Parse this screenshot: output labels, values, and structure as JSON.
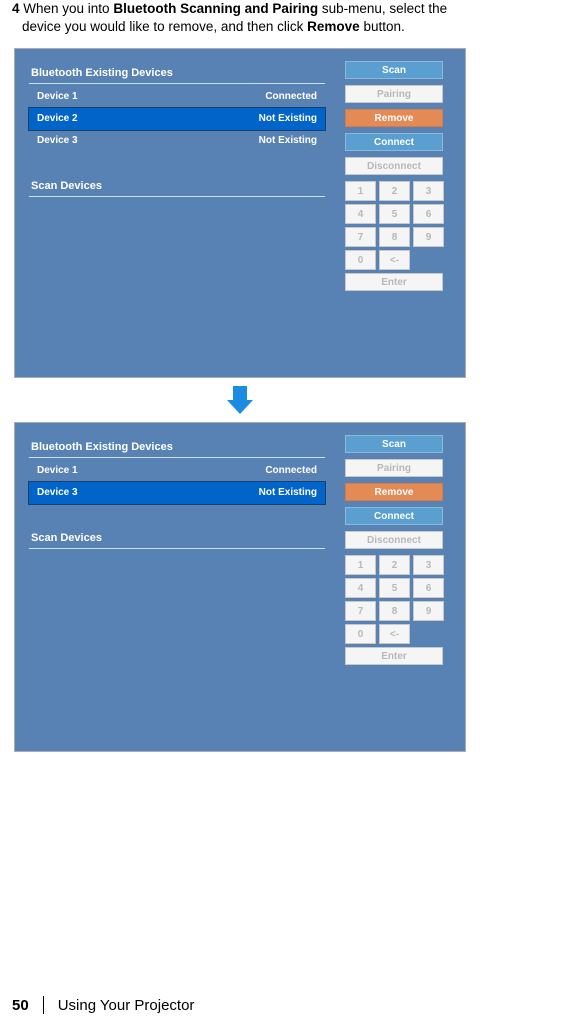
{
  "instruction": {
    "step_prefix": "4",
    "text1": " When you into ",
    "bold1": "Bluetooth Scanning and Pairing",
    "text2": " sub-menu, select the",
    "line2_a": "device you would like to remove, and then click ",
    "bold2": "Remove",
    "line2_b": " button."
  },
  "panel1": {
    "heading": "Bluetooth Existing Devices",
    "rows": [
      {
        "name": "Device 1",
        "status": "Connected",
        "selected": false
      },
      {
        "name": "Device 2",
        "status": "Not Existing",
        "selected": true
      },
      {
        "name": "Device 3",
        "status": "Not Existing",
        "selected": false
      }
    ],
    "scan_heading": "Scan Devices"
  },
  "panel2": {
    "heading": "Bluetooth Existing Devices",
    "rows": [
      {
        "name": "Device 1",
        "status": "Connected",
        "selected": false
      },
      {
        "name": "Device 3",
        "status": "Not Existing",
        "selected": true
      }
    ],
    "scan_heading": "Scan Devices"
  },
  "side": {
    "scan": "Scan",
    "pairing": "Pairing",
    "remove": "Remove",
    "connect": "Connect",
    "disconnect": "Disconnect",
    "enter": "Enter",
    "keys": [
      "1",
      "2",
      "3",
      "4",
      "5",
      "6",
      "7",
      "8",
      "9",
      "0",
      "<-"
    ]
  },
  "footer": {
    "page": "50",
    "chapter": "Using Your Projector"
  }
}
